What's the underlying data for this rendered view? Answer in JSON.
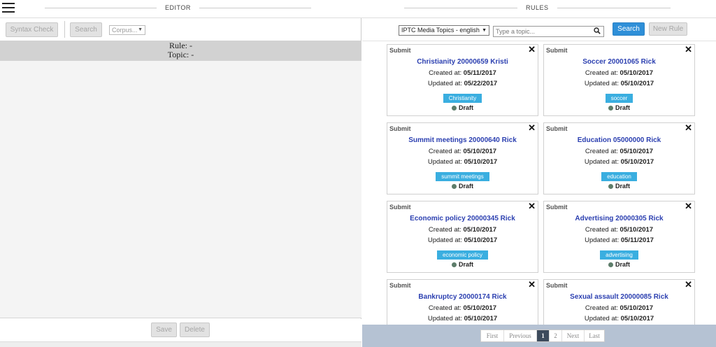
{
  "header": {
    "editor_title": "EDITOR",
    "rules_title": "RULES",
    "menu_icon": "hamburger-icon"
  },
  "editor": {
    "syntax_check_label": "Syntax Check",
    "search_label": "Search",
    "corpus_value": "Corpus...",
    "rule_label": "Rule: -",
    "topic_label": "Topic: -",
    "save_label": "Save",
    "delete_label": "Delete"
  },
  "rules": {
    "taxonomy_value": "IPTC Media Topics - english",
    "topic_placeholder": "Type a topic...",
    "search_label": "Search",
    "new_rule_label": "New Rule",
    "created_prefix": "Created at:",
    "updated_prefix": "Updated at:",
    "submit_label": "Submit",
    "close_glyph": "✕",
    "cards": [
      {
        "title": "Christianity 20000659 Kristi",
        "created": "05/11/2017",
        "updated": "05/22/2017",
        "tag": "Christianity",
        "status": "Draft"
      },
      {
        "title": "Soccer 20001065 Rick",
        "created": "05/10/2017",
        "updated": "05/10/2017",
        "tag": "soccer",
        "status": "Draft"
      },
      {
        "title": "Summit meetings 20000640 Rick",
        "created": "05/10/2017",
        "updated": "05/10/2017",
        "tag": "summit meetings",
        "status": "Draft"
      },
      {
        "title": "Education 05000000 Rick",
        "created": "05/10/2017",
        "updated": "05/10/2017",
        "tag": "education",
        "status": "Draft"
      },
      {
        "title": "Economic policy 20000345 Rick",
        "created": "05/10/2017",
        "updated": "05/10/2017",
        "tag": "economic policy",
        "status": "Draft"
      },
      {
        "title": "Advertising 20000305 Rick",
        "created": "05/10/2017",
        "updated": "05/11/2017",
        "tag": "advertising",
        "status": "Draft"
      },
      {
        "title": "Bankruptcy 20000174 Rick",
        "created": "05/10/2017",
        "updated": "05/10/2017",
        "tag": "",
        "status": ""
      },
      {
        "title": "Sexual assault 20000085 Rick",
        "created": "05/10/2017",
        "updated": "05/10/2017",
        "tag": "",
        "status": ""
      }
    ]
  },
  "pagination": {
    "first": "First",
    "previous": "Previous",
    "pages": [
      "1",
      "2"
    ],
    "active_page": "1",
    "next": "Next",
    "last": "Last"
  },
  "colors": {
    "primary_button": "#2e8fd8",
    "tag": "#3aaee0",
    "card_title": "#2b3fb0",
    "pagination_bar": "#b5c2d3",
    "active_page": "#3d4b5c",
    "draft_dot": "#5d7d6a"
  }
}
